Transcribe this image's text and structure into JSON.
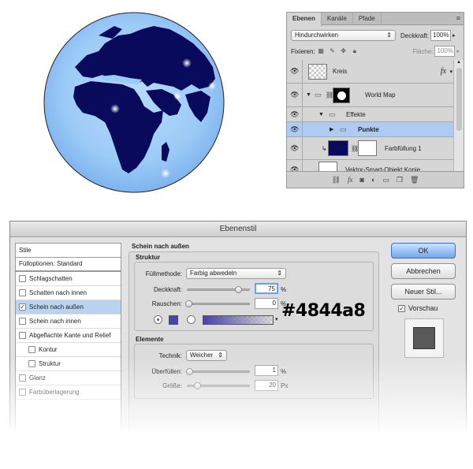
{
  "layers_panel": {
    "tabs": [
      "Ebenen",
      "Kanäle",
      "Pfade"
    ],
    "menu_icon": "panel-menu-icon",
    "blend_mode": "Hindurchwirken",
    "opacity_label": "Deckkraft:",
    "opacity_value": "100%",
    "lock_label": "Fixieren:",
    "fill_label": "Fläche:",
    "fill_value": "100%",
    "layers": [
      {
        "name": "Kreis",
        "fx": "fx"
      },
      {
        "name": "World Map"
      },
      {
        "name": "Effekte"
      },
      {
        "name": "Punkte"
      },
      {
        "name": "Farbfüllung 1"
      },
      {
        "name": "Vektor-Smart-Objekt Kopie"
      }
    ]
  },
  "dialog": {
    "title": "Ebenenstil",
    "style_list": {
      "header": "Stile",
      "fill_options": "Fülloptionen: Standard",
      "items": [
        {
          "label": "Schlagschatten",
          "checked": false
        },
        {
          "label": "Schatten nach innen",
          "checked": false
        },
        {
          "label": "Schein nach außen",
          "checked": true
        },
        {
          "label": "Schein nach innen",
          "checked": false
        },
        {
          "label": "Abgeflachte Kante und Relief",
          "checked": false
        },
        {
          "label": "Kontur",
          "checked": false
        },
        {
          "label": "Struktur",
          "checked": false
        },
        {
          "label": "Glanz",
          "checked": false
        },
        {
          "label": "Farbüberlagerung",
          "checked": false
        }
      ]
    },
    "outer_glow": {
      "title": "Schein nach außen",
      "structure_title": "Struktur",
      "blend_label": "Füllmethode:",
      "blend_value": "Farbig abwedeln",
      "opacity_label": "Deckkraft:",
      "opacity_value": "75",
      "opacity_unit": "%",
      "noise_label": "Rauschen:",
      "noise_value": "0",
      "noise_unit": "%",
      "elements_title": "Elemente",
      "technique_label": "Technik:",
      "technique_value": "Weicher",
      "spread_label": "Überfüllen:",
      "spread_value": "1",
      "spread_unit": "%",
      "size_label": "Größe:",
      "size_value": "20",
      "size_unit": "Px"
    },
    "buttons": {
      "ok": "OK",
      "cancel": "Abbrechen",
      "new_style": "Neuer Stil...",
      "preview": "Vorschau"
    }
  },
  "hex_annotation": "#4844a8",
  "colors": {
    "glow": "#4844a8",
    "ocean": "#98c8f8",
    "land": "#0b0b5e",
    "selection": "#aecbf1",
    "ok_button": "#6fa6ee"
  }
}
